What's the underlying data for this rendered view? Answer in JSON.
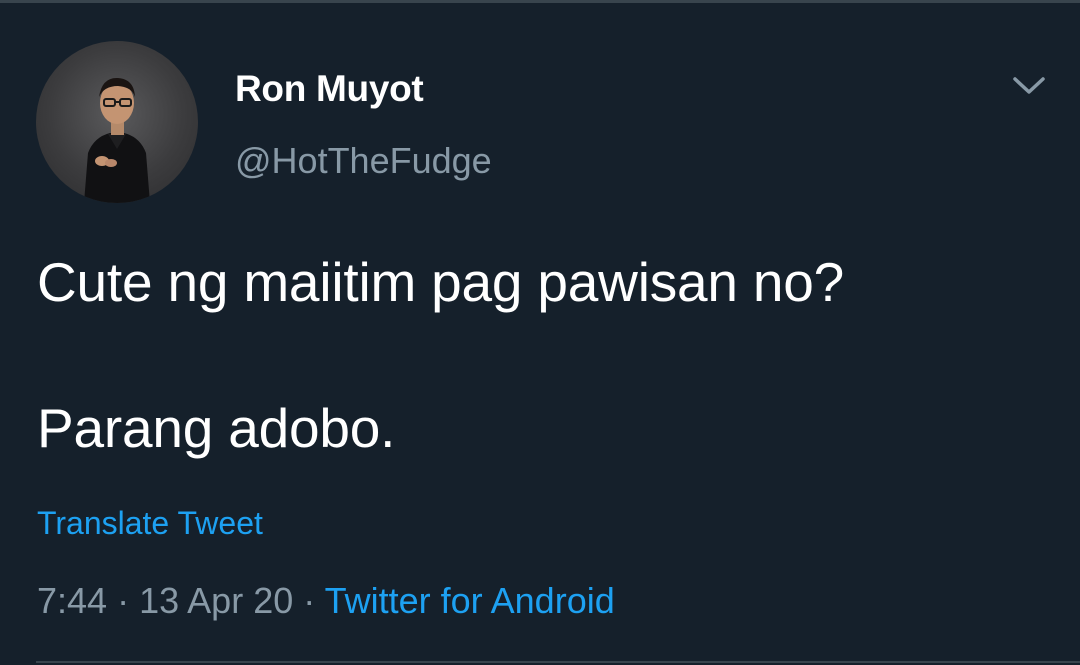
{
  "tweet": {
    "author": {
      "display_name": "Ron Muyot",
      "handle": "@HotTheFudge"
    },
    "text_lines": [
      "Cute ng maiitim pag pawisan no?",
      "Parang adobo."
    ],
    "translate_label": "Translate Tweet",
    "meta": {
      "time": "7:44",
      "date": "13 Apr 20",
      "separator": "·",
      "source": "Twitter for Android"
    }
  },
  "icons": {
    "more": "chevron-down-icon",
    "avatar": "profile-photo"
  },
  "colors": {
    "background": "#15202b",
    "primary_text": "#ffffff",
    "secondary_text": "#8899a6",
    "accent": "#1da1f2",
    "divider": "#38444d"
  }
}
